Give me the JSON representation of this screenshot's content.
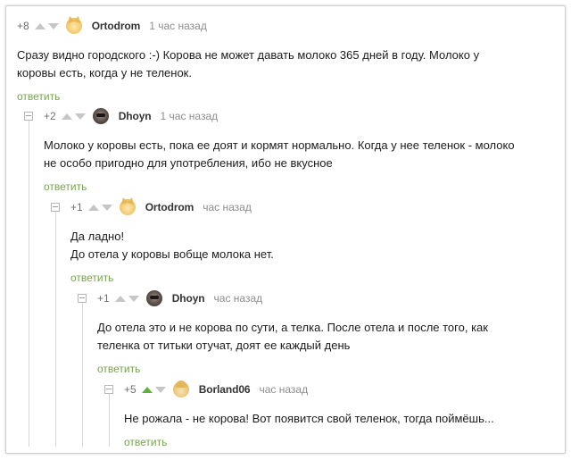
{
  "comments": [
    {
      "score": "+8",
      "author": "Ortodrom",
      "time": "1 час назад",
      "avatar_icon": "cat-avatar-icon",
      "lines": [
        "Сразу видно городского :-) Корова не может давать молоко 365 дней в году. Молоко у",
        "коровы есть, когда у не теленок."
      ],
      "reply_label": "ответить"
    },
    {
      "score": "+2",
      "author": "Dhoyn",
      "time": "1 час назад",
      "avatar_icon": "dark-avatar-icon",
      "lines": [
        "Молоко у коровы есть, пока ее доят и кормят нормально. Когда у нее теленок - молоко",
        "не особо пригодно для употребления, ибо не вкусное"
      ],
      "reply_label": "ответить"
    },
    {
      "score": "+1",
      "author": "Ortodrom",
      "time": "час назад",
      "avatar_icon": "cat-avatar-icon",
      "lines": [
        "Да ладно!",
        "До отела у коровы вобще молока нет."
      ],
      "reply_label": "ответить"
    },
    {
      "score": "+1",
      "author": "Dhoyn",
      "time": "час назад",
      "avatar_icon": "dark-avatar-icon",
      "lines": [
        "До отела это и не корова по сути, а телка. После отела и после того, как",
        "теленка от титьки отучат, доят ее каждый день"
      ],
      "reply_label": "ответить"
    },
    {
      "score": "+5",
      "author": "Borland06",
      "time": "час назад",
      "avatar_icon": "blond-avatar-icon",
      "upvoted": true,
      "lines": [
        "Не рожала - не корова! Вот появится свой теленок, тогда поймёшь..."
      ],
      "reply_label": "ответить"
    }
  ],
  "colors": {
    "upvote_active": "#5fb13c",
    "reply_link": "#7aa055",
    "vote_inactive": "#c6c6c6"
  }
}
